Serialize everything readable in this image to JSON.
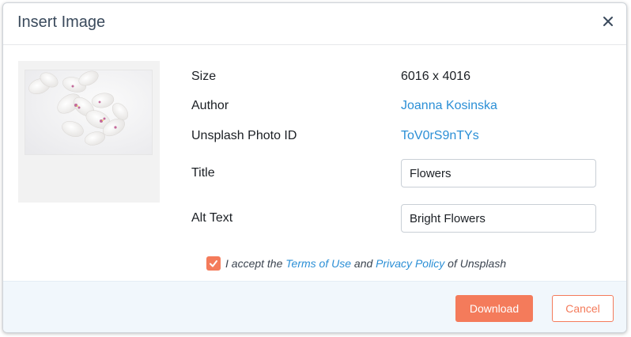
{
  "dialog": {
    "title": "Insert Image",
    "close_icon": "close-icon"
  },
  "image": {
    "thumbnail_icon": "flowers-photo",
    "info": {
      "size_label": "Size",
      "size_value": "6016 x 4016",
      "author_label": "Author",
      "author_value": "Joanna Kosinska",
      "photo_id_label": "Unsplash Photo ID",
      "photo_id_value": "ToV0rS9nTYs"
    },
    "title_field": {
      "label": "Title",
      "value": "Flowers"
    },
    "alt_field": {
      "label": "Alt Text",
      "value": "Bright Flowers"
    }
  },
  "consent": {
    "checked": true,
    "text_before": "I accept the ",
    "terms_link": "Terms of Use",
    "text_middle": " and ",
    "privacy_link": "Privacy Policy",
    "text_after": " of Unsplash"
  },
  "footer": {
    "download_label": "Download",
    "cancel_label": "Cancel"
  },
  "colors": {
    "accent": "#f47b5b",
    "link": "#2b8fd6",
    "footer_bg": "#f1f7fc"
  }
}
